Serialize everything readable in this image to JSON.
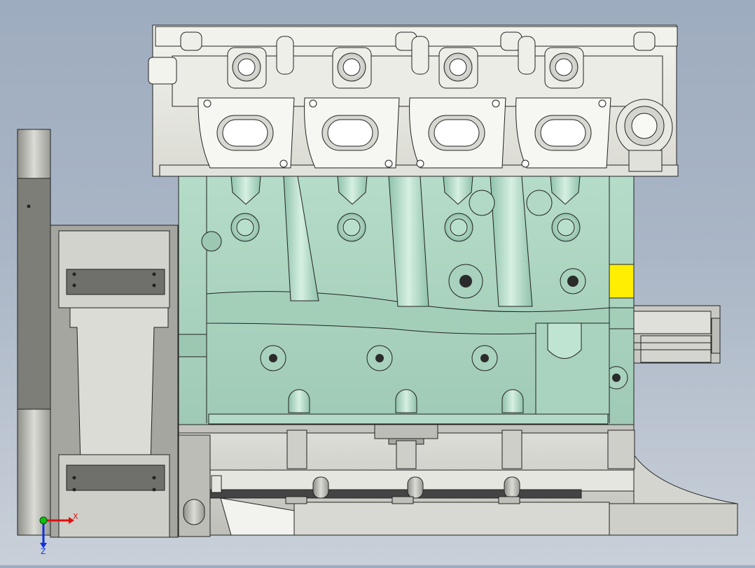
{
  "viewport": {
    "view": "front",
    "render_mode": "shaded-with-edges",
    "background_top": "#9eacbf",
    "background_bottom": "#c9d0d9"
  },
  "model": {
    "name": "",
    "colors": {
      "cylinder_head": "#e7e7e1",
      "engine_block": "#a9d4bf",
      "gear_housing": "#bdbdb7",
      "oil_pan": "#d2d2cc",
      "highlight_face": "#ffee00",
      "edge": "#1a1a1a"
    },
    "cylinders": 4
  },
  "triad": {
    "x_label": "X",
    "z_label": "Z",
    "x_color": "#e01010",
    "y_color": "#10c010",
    "z_color": "#1030e0"
  }
}
